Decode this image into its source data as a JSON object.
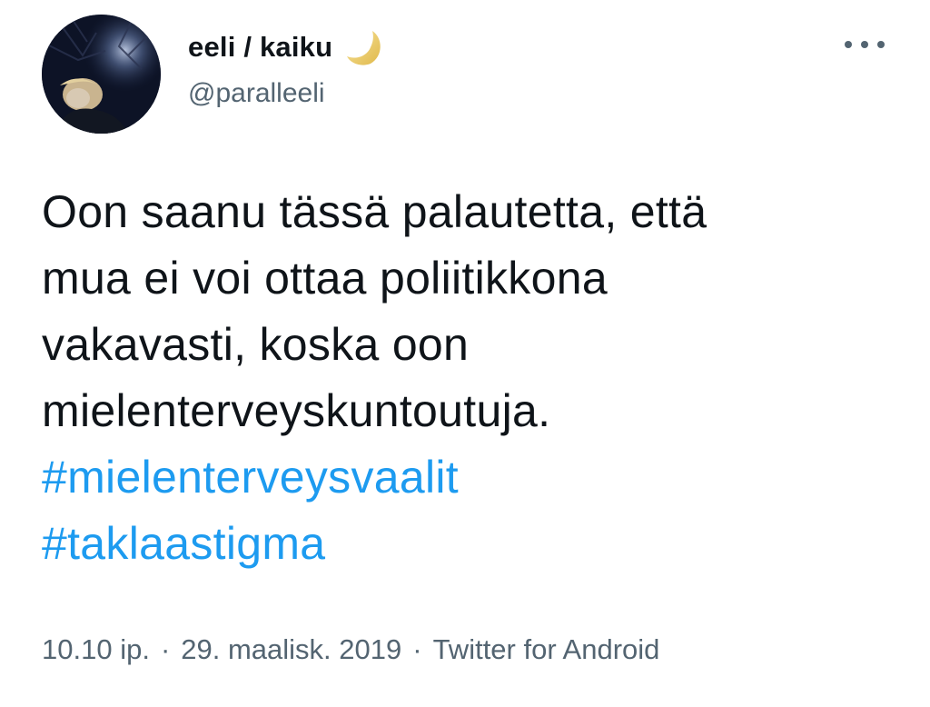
{
  "author": {
    "display_name": "eeli / kaiku",
    "handle": "@paralleeli",
    "name_emoji": "crescent-moon-icon",
    "avatar": "profile-photo"
  },
  "header": {
    "more_icon": "more-options-icon"
  },
  "tweet": {
    "text_lines": [
      "Oon saanu tässä palautetta, että",
      "mua ei voi ottaa poliitikkona",
      "vakavasti, koska oon",
      "mielenterveyskuntoutuja."
    ],
    "hashtags": [
      "#mielenterveysvaalit",
      "#taklaastigma"
    ]
  },
  "meta": {
    "time": "10.10 ip.",
    "separator": "·",
    "date": "29. maalisk. 2019",
    "source": "Twitter for Android"
  },
  "colors": {
    "text": "#0f1419",
    "secondary": "#536471",
    "link": "#1d9bf0",
    "background": "#ffffff"
  }
}
